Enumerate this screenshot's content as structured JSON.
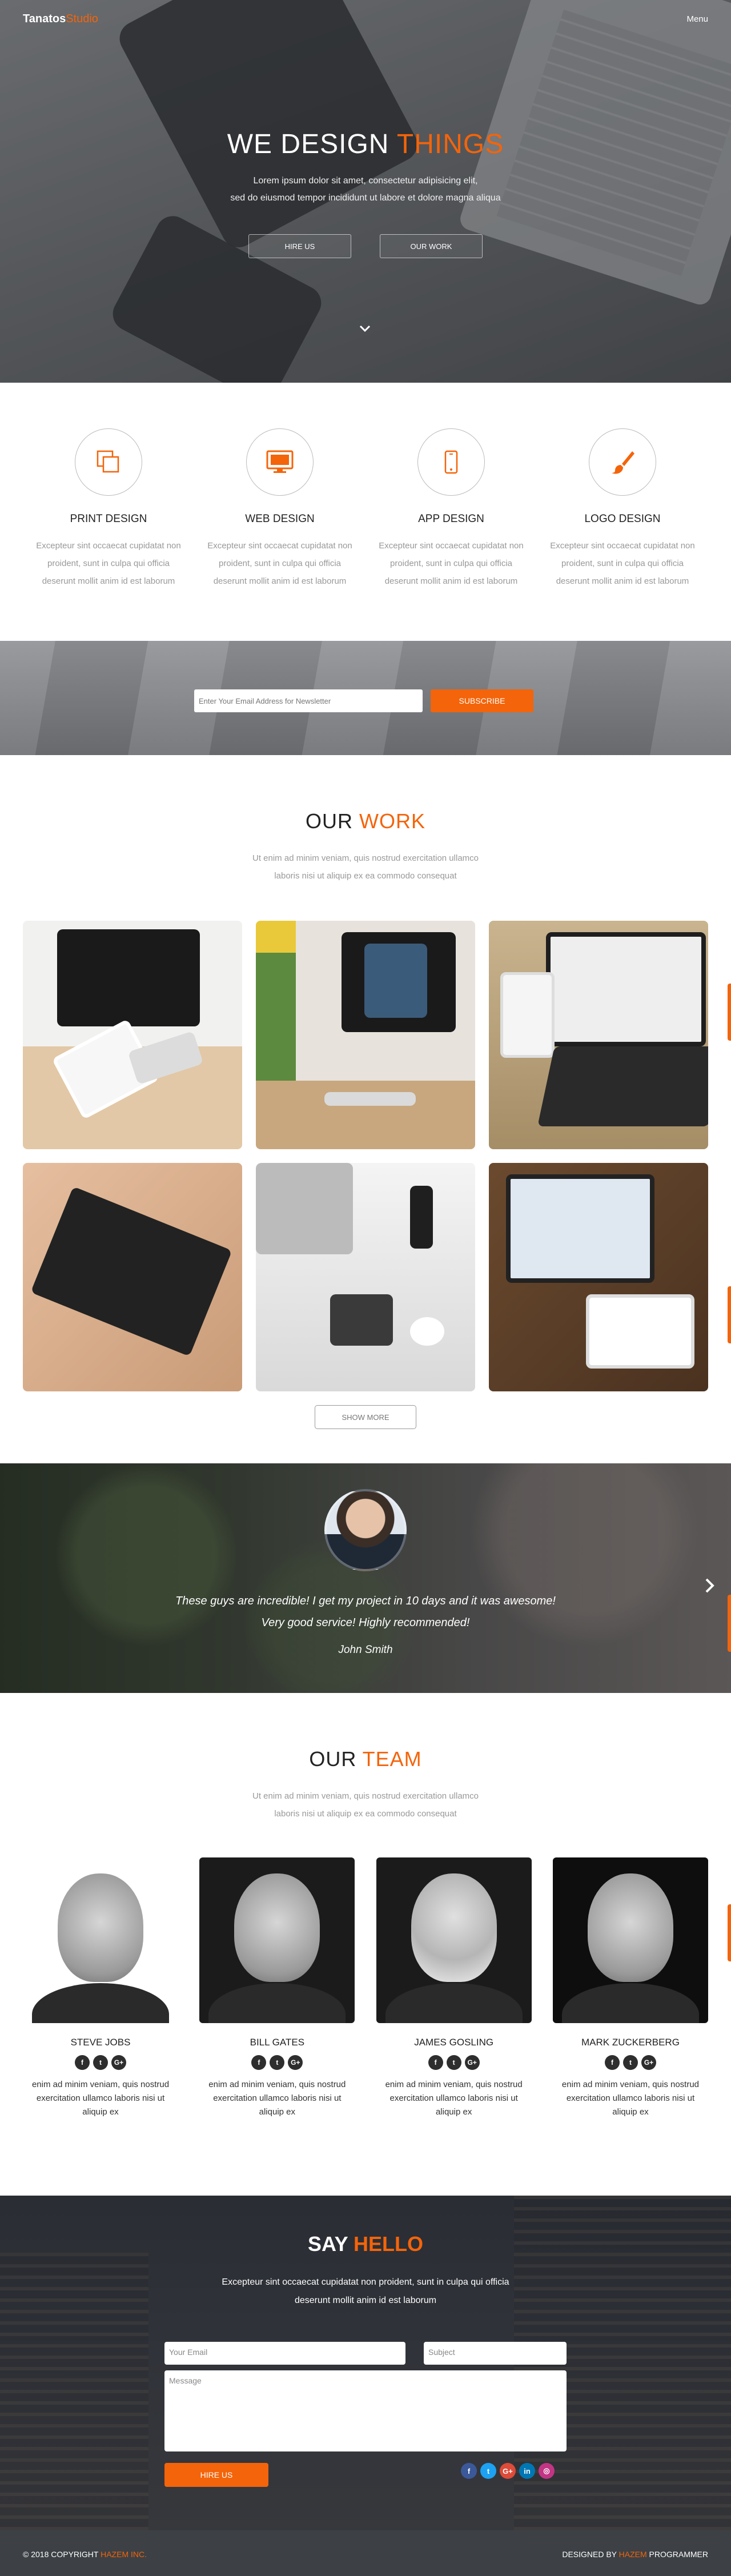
{
  "nav": {
    "logo_main": "Tanatos",
    "logo_accent": "Studio",
    "menu": "Menu"
  },
  "hero": {
    "title_main": "WE DESIGN ",
    "title_accent": "THINGS",
    "line1": "Lorem ipsum dolor sit amet, consectetur adipisicing elit,",
    "line2": "sed do eiusmod tempor incididunt ut labore et dolore magna aliqua",
    "hire_btn": "HIRE US",
    "work_btn": "OUR WORK",
    "scroll_icon": "chevron-down-icon"
  },
  "services": [
    {
      "title": "PRINT DESIGN",
      "icon": "print-design-icon",
      "text": "Excepteur sint occaecat cupidatat non proident, sunt in culpa qui officia deserunt mollit anim id est laborum"
    },
    {
      "title": "WEB DESIGN",
      "icon": "monitor-icon",
      "text": "Excepteur sint occaecat cupidatat non proident, sunt in culpa qui officia deserunt mollit anim id est laborum"
    },
    {
      "title": "APP DESIGN",
      "icon": "smartphone-icon",
      "text": "Excepteur sint occaecat cupidatat non proident, sunt in culpa qui officia deserunt mollit anim id est laborum"
    },
    {
      "title": "LOGO DESIGN",
      "icon": "paintbrush-icon",
      "text": "Excepteur sint occaecat cupidatat non proident, sunt in culpa qui officia deserunt mollit anim id est laborum"
    }
  ],
  "newsletter": {
    "placeholder": "Enter Your Email Address for Newsletter",
    "button": "SUBSCRIBE"
  },
  "work": {
    "title_main": "OUR ",
    "title_accent": "WORK",
    "sub1": "Ut enim ad minim veniam, quis nostrud exercitation ullamco",
    "sub2": "laboris nisi ut aliquip ex ea commodo consequat",
    "show_more": "SHOW MORE"
  },
  "testimonial": {
    "line1": "These guys are incredible! I get my project in 10 days and it was awesome!",
    "line2": "Very good service! Highly recommended!",
    "author": "John Smith"
  },
  "team": {
    "title_main": "OUR ",
    "title_accent": "TEAM",
    "sub1": "Ut enim ad minim veniam, quis nostrud exercitation ullamco",
    "sub2": "laboris nisi ut aliquip ex ea commodo consequat",
    "members": [
      {
        "name": "STEVE JOBS",
        "text": "enim ad minim veniam, quis nostrud exercitation ullamco laboris nisi ut aliquip ex"
      },
      {
        "name": "BILL GATES",
        "text": "enim ad minim veniam, quis nostrud exercitation ullamco laboris nisi ut aliquip ex"
      },
      {
        "name": "JAMES GOSLING",
        "text": "enim ad minim veniam, quis nostrud exercitation ullamco laboris nisi ut aliquip ex"
      },
      {
        "name": "MARK ZUCKERBERG",
        "text": "enim ad minim veniam, quis nostrud exercitation ullamco laboris nisi ut aliquip ex"
      }
    ],
    "social_glyphs": {
      "facebook": "f",
      "twitter": "t",
      "google": "G+"
    }
  },
  "contact": {
    "title_main": "SAY ",
    "title_accent": "HELLO",
    "sub1": "Excepteur sint occaecat cupidatat non proident, sunt in culpa qui officia",
    "sub2": "deserunt mollit anim id est laborum",
    "email_placeholder": "Your Email",
    "subject_placeholder": "Subject",
    "message_placeholder": "Message",
    "button": "HIRE US",
    "social_glyphs": {
      "facebook": "f",
      "twitter": "t",
      "google": "G+",
      "linkedin": "in",
      "instagram": "◎"
    }
  },
  "footer": {
    "copyright_prefix": "© 2018 COPYRIGHT ",
    "copyright_accent": "HAZEM INC.",
    "designed_prefix": "DESIGNED BY ",
    "designed_accent": "HAZEM",
    "designed_suffix": " PROGRAMMER"
  },
  "colors": {
    "accent": "#f4640a",
    "footer_bg": "#3d4145"
  }
}
